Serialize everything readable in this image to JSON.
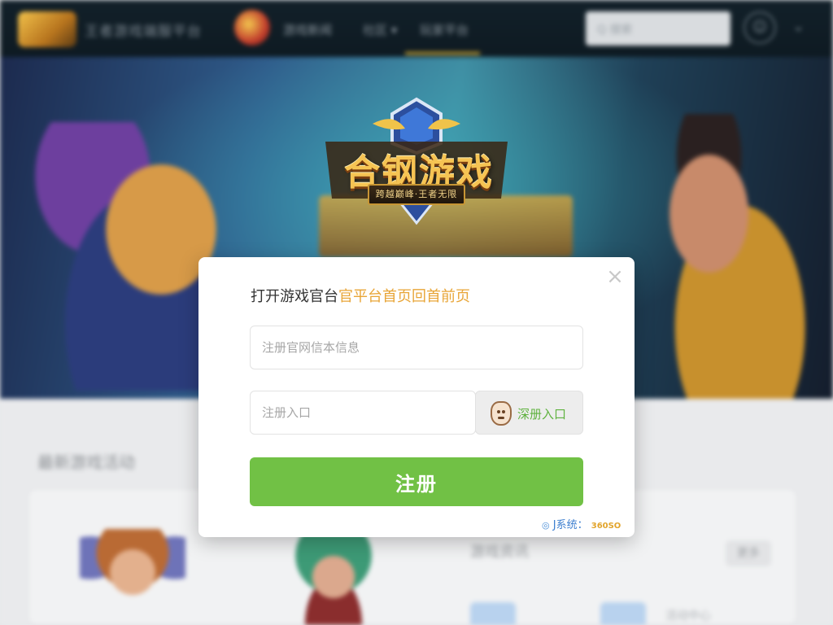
{
  "colors": {
    "accent_green": "#71c145",
    "highlight_orange": "#e8a537",
    "nav_bg": "#122029",
    "side_label_green": "#5fb23f"
  },
  "background": {
    "site_title": "王者游戏端服平台",
    "nav_links": [
      "游戏新闻",
      "社区 ▾",
      "玩家平台"
    ],
    "search_placeholder": "Q 搜索",
    "user_icon": "user-icon",
    "content_heading": "最新游戏活动",
    "panel_title": "游戏资讯",
    "panel_pill": "更多",
    "panel_tag_text": "活动中心"
  },
  "emblem": {
    "title": "合钢游戏",
    "subtitle": "跨越巅峰·王者无限"
  },
  "modal": {
    "close_label": "×",
    "title_prefix": "打开游戏官台",
    "title_highlight": "官平台首页回首前页",
    "field1_placeholder": "注册官网信本信息",
    "field2_placeholder": "注册入口",
    "side_button_label": "深册入口",
    "side_button_icon": "face-icon",
    "submit_label": "注册",
    "footer_icon": "◎",
    "footer_main": "J系统：",
    "footer_tag": "360SO"
  }
}
